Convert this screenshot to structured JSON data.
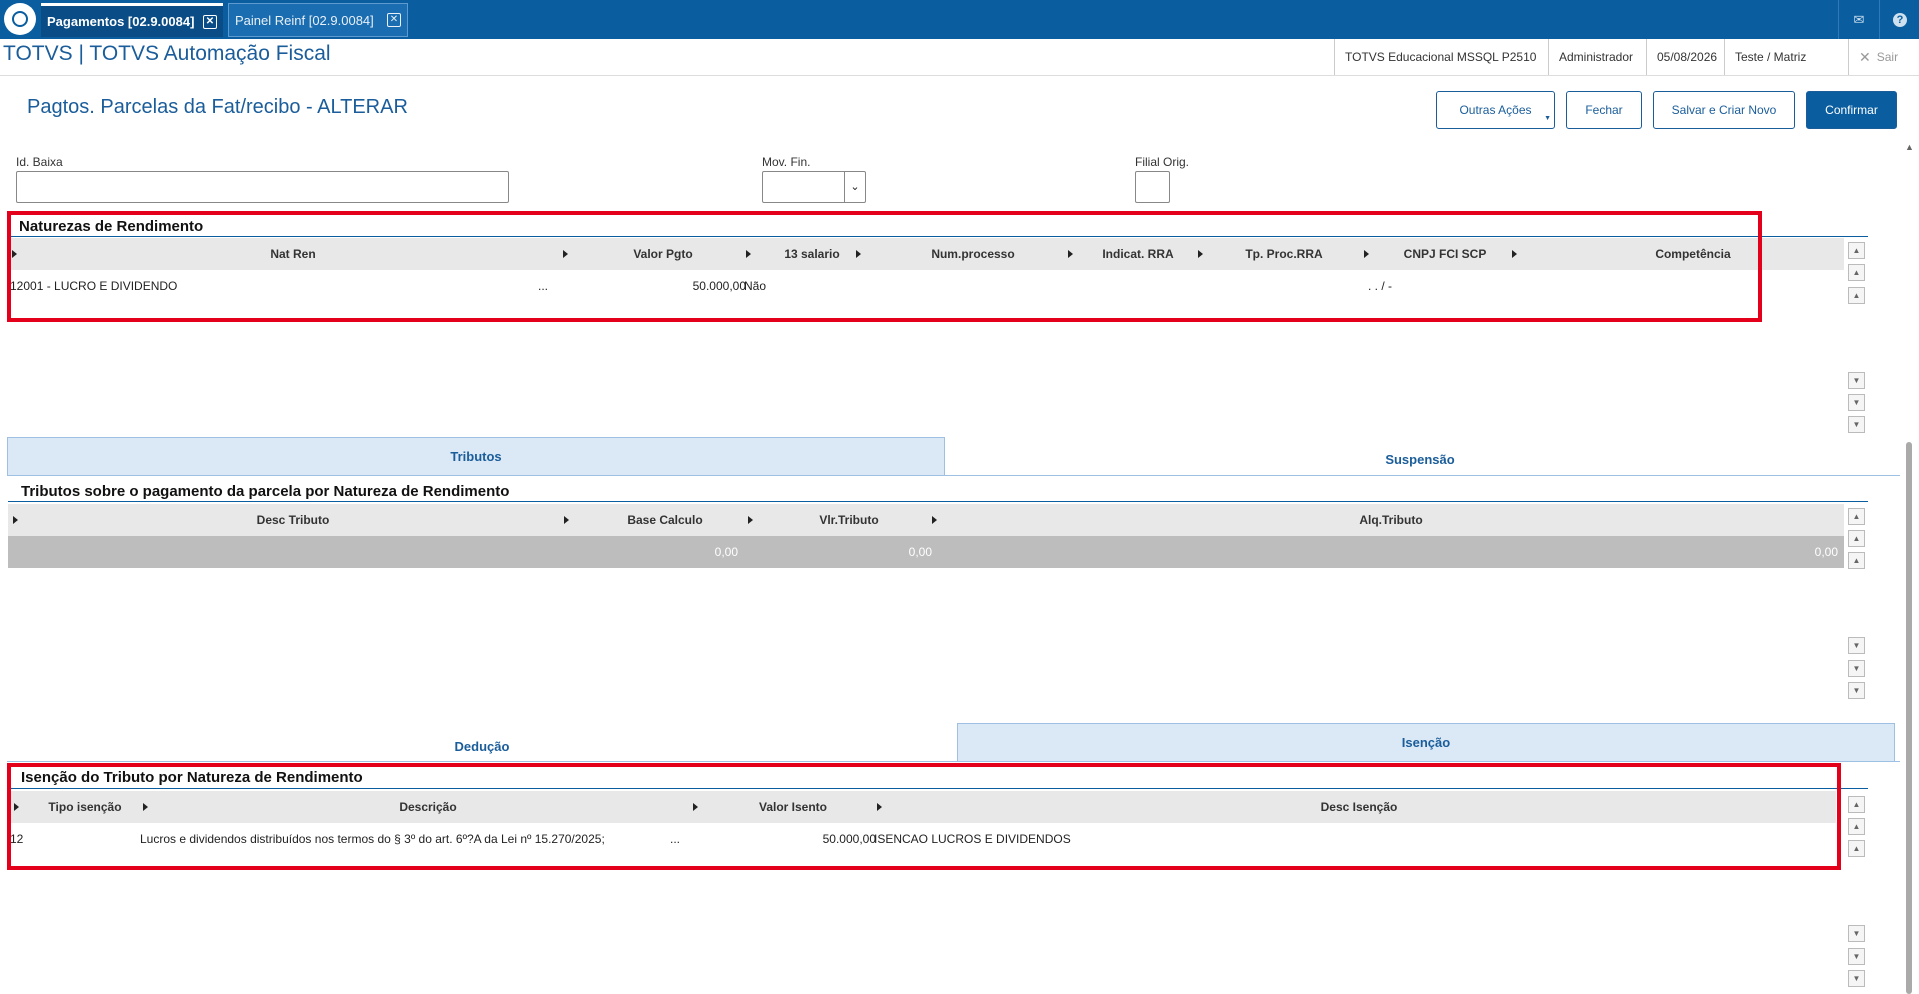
{
  "topbar": {
    "tabs": [
      {
        "label": "Pagamentos [02.9.0084]"
      },
      {
        "label": "Painel Reinf [02.9.0084]"
      }
    ]
  },
  "header": {
    "app_title": "TOTVS | TOTVS Automação Fiscal",
    "environment": "TOTVS Educacional MSSQL P2510",
    "user": "Administrador",
    "date": "05/08/2026",
    "branch": "Teste / Matriz",
    "exit_label": "Sair"
  },
  "page": {
    "title": "Pagtos. Parcelas da Fat/recibo - ALTERAR",
    "buttons": {
      "other_actions": "Outras Ações",
      "close": "Fechar",
      "save_new": "Salvar e Criar Novo",
      "confirm": "Confirmar"
    }
  },
  "fields": {
    "id_baixa_label": "Id. Baixa",
    "mov_fin_label": "Mov. Fin.",
    "filial_orig_label": "Filial Orig."
  },
  "naturezas": {
    "title": "Naturezas de Rendimento",
    "columns": [
      "Nat Ren",
      "Valor Pgto",
      "13 salario",
      "Num.processo",
      "Indicat. RRA",
      "Tp. Proc.RRA",
      "CNPJ FCI SCP",
      "Competência"
    ],
    "row": {
      "nat_ren": "12001 - LUCRO E DIVIDENDO",
      "ellipsis": "...",
      "valor_pgto": "50.000,00",
      "decimo_terceiro": "Não",
      "cnpj": ".  .  /   -"
    }
  },
  "tabs_tributos": {
    "tab1": "Tributos",
    "tab2": "Suspensão"
  },
  "tributos": {
    "title": "Tributos sobre o pagamento da parcela por Natureza de Rendimento",
    "columns": [
      "Desc Tributo",
      "Base Calculo",
      "Vlr.Tributo",
      "Alq.Tributo"
    ],
    "row": {
      "base_calculo": "0,00",
      "vlr_tributo": "0,00",
      "alq_tributo": "0,00"
    }
  },
  "tabs_isencao": {
    "tab1": "Dedução",
    "tab2": "Isenção"
  },
  "isencao": {
    "title": "Isenção do Tributo por Natureza de Rendimento",
    "columns": [
      "Tipo isenção",
      "Descrição",
      "Valor Isento",
      "Desc Isenção"
    ],
    "row": {
      "tipo": "12",
      "descricao": "Lucros e dividendos distribuídos nos termos do § 3º do art. 6º?A da Lei nº 15.270/2025;",
      "ellipsis": "...",
      "valor_isento": "50.000,00",
      "desc_isencao": "ISENCAO LUCROS E DIVIDENDOS"
    }
  },
  "colors": {
    "brand": "#0a5ea0",
    "highlight": "#e4001b"
  }
}
